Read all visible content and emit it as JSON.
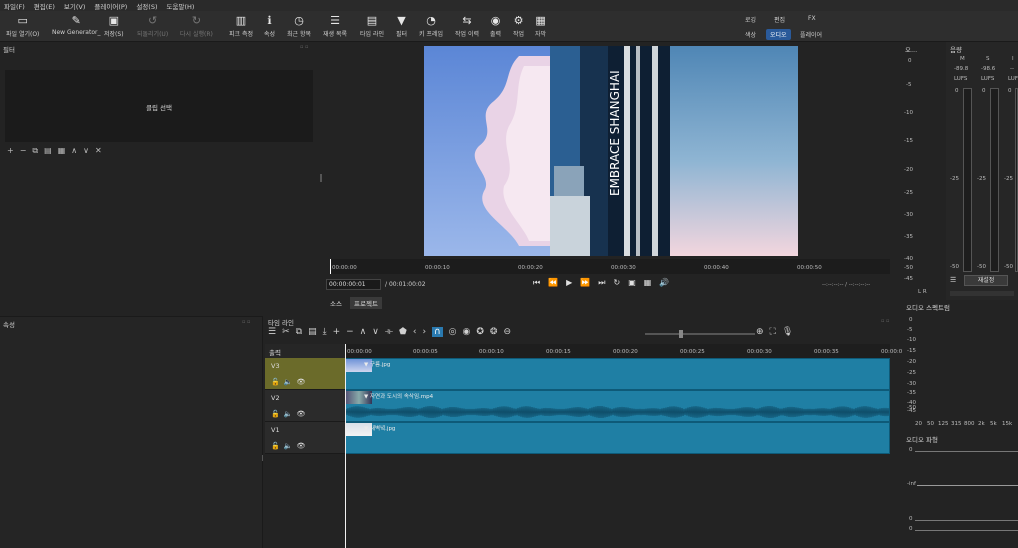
{
  "menu": [
    "파일(F)",
    "편집(E)",
    "보기(V)",
    "플레이어(P)",
    "설정(S)",
    "도움말(H)"
  ],
  "toolbar": {
    "open": "파일 열기(O)",
    "new_generator": "New Generator_",
    "save": "저장(S)",
    "undo": "되돌리기(U)",
    "redo": "다시 실행(R)",
    "peak_meter": "피크 측정",
    "properties": "속성",
    "recent": "최근 항목",
    "playlist": "재생 목록",
    "timeline": "타임 라인",
    "filters": "필터",
    "keyframes": "키 프레임",
    "history": "작업 이력",
    "export": "출력",
    "jobs": "작업",
    "subtitles": "자막"
  },
  "layouts": {
    "logging": "로깅",
    "editing": "편집",
    "fx": "FX",
    "color": "색상",
    "audio": "오디오",
    "player": "플레이어"
  },
  "filters_panel": {
    "title": "필터",
    "select_clip": "클립 선택"
  },
  "properties_panel": {
    "title": "속성"
  },
  "player": {
    "timecode": "00:00:00:01",
    "duration": "00:01:00:02",
    "in_out": "--:--:--:-- / --:--:--:--",
    "tab_source": "소스",
    "tab_project": "프로젝트",
    "ruler": [
      "00:00:00",
      "00:00:10",
      "00:00:20",
      "00:00:30",
      "00:00:40",
      "00:00:50"
    ]
  },
  "audio_meter": {
    "title": "오...",
    "scale": [
      "0",
      "-5",
      "-10",
      "-15",
      "-20",
      "-25",
      "-30",
      "-35",
      "-40",
      "-45",
      "-50"
    ],
    "lr": "L R"
  },
  "loudness": {
    "title": "음량",
    "cols": [
      "M",
      "S",
      "I"
    ],
    "values": [
      "-89.8",
      "-98.6",
      "--"
    ],
    "unit": "LUFS",
    "top_vals": [
      "0",
      "0",
      "0"
    ],
    "mid": "-25",
    "bottom": "-50",
    "reset": "재설정"
  },
  "spectrum": {
    "title": "오디오 스펙트럼",
    "scale": [
      "0",
      "-5",
      "-10",
      "-15",
      "-20",
      "-25",
      "-30",
      "-35",
      "-40",
      "-45",
      "-50"
    ],
    "freq": [
      "20",
      "50",
      "125",
      "315",
      "800",
      "2k",
      "5k",
      "15k"
    ]
  },
  "waveform": {
    "title": "오디오 파형",
    "labels": [
      "0",
      "-inf",
      "0",
      "0"
    ]
  },
  "timeline": {
    "title": "타임 라인",
    "output_label": "출력",
    "ruler": [
      "00:00:00",
      "00:00:05",
      "00:00:10",
      "00:00:15",
      "00:00:20",
      "00:00:25",
      "00:00:30",
      "00:00:35",
      "00:00:0"
    ],
    "tracks": [
      {
        "name": "V3",
        "clip": "구름.jpg"
      },
      {
        "name": "V2",
        "clip": "자연과 도시의 속삭임.mp4"
      },
      {
        "name": "V1",
        "clip": "새벽녘.jpg"
      }
    ]
  },
  "colors": {
    "accent": "#2a5a9a",
    "clip": "#1f7fa4",
    "selected_track": "#6b6b2a"
  }
}
